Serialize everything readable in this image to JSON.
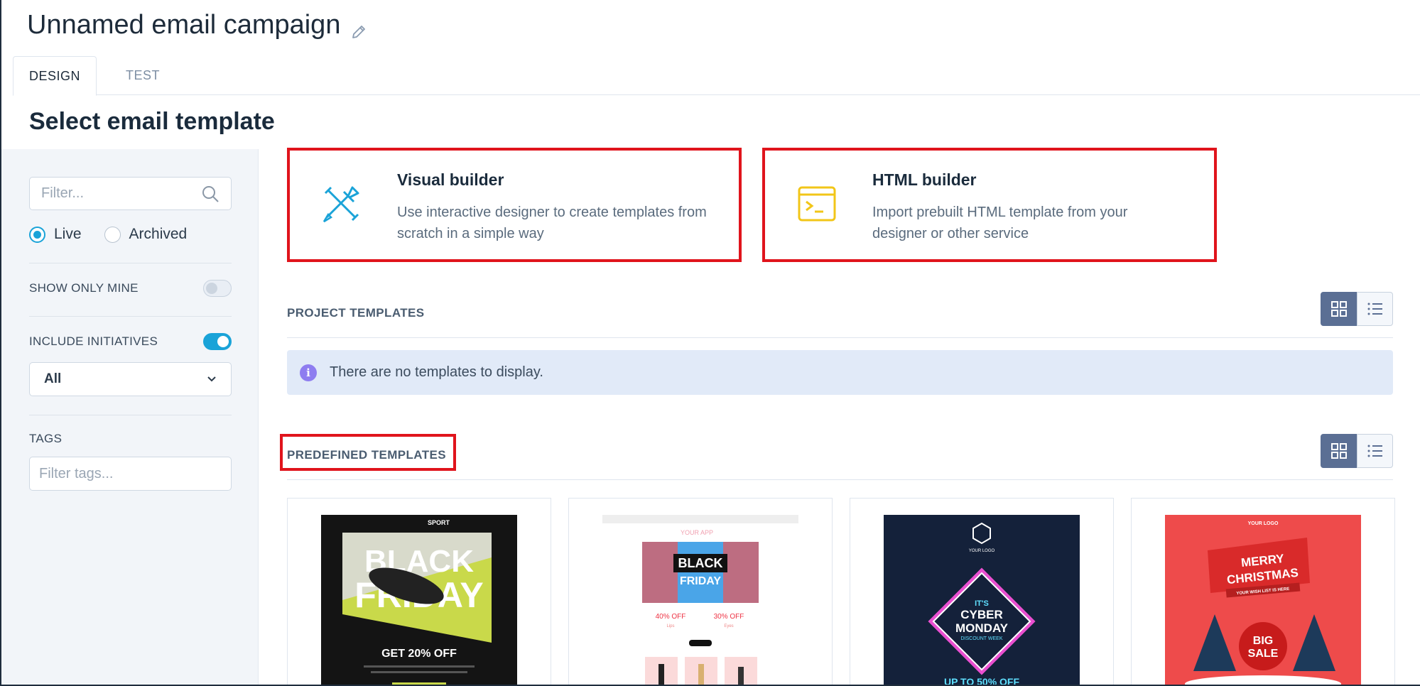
{
  "header": {
    "title": "Unnamed email campaign",
    "edit_icon": "pencil-icon"
  },
  "tabs": [
    {
      "label": "DESIGN",
      "active": true
    },
    {
      "label": "TEST",
      "active": false
    }
  ],
  "section_title": "Select email template",
  "sidebar": {
    "filter_placeholder": "Filter...",
    "status_options": [
      {
        "label": "Live",
        "selected": true
      },
      {
        "label": "Archived",
        "selected": false
      }
    ],
    "show_only_mine": {
      "label": "SHOW ONLY MINE",
      "on": false
    },
    "include_initiatives": {
      "label": "INCLUDE INITIATIVES",
      "on": true
    },
    "initiative_select": {
      "value": "All"
    },
    "tags_label": "TAGS",
    "tags_placeholder": "Filter tags..."
  },
  "builders": {
    "visual": {
      "title": "Visual builder",
      "description": "Use interactive designer to create templates from scratch in a simple way",
      "icon": "brush-pen-icon",
      "icon_color": "#1aa3d8"
    },
    "html": {
      "title": "HTML builder",
      "description": "Import prebuilt HTML template from your designer or other service",
      "icon": "terminal-icon",
      "icon_color": "#f2c618"
    }
  },
  "project_templates": {
    "label": "PROJECT TEMPLATES",
    "empty_message": "There are no templates to display."
  },
  "predefined_templates": {
    "label": "PREDEFINED TEMPLATES",
    "cards": [
      {
        "brand": "SPORT",
        "headline1": "BLACK",
        "headline2": "FRIDAY",
        "offer": "GET 20% OFF"
      },
      {
        "brand": "YOUR APP",
        "headline1": "BLACK",
        "headline2": "FRIDAY",
        "offer_left": "40% OFF",
        "offer_right": "30% OFF",
        "sub_left": "Lips",
        "sub_right": "Eyes"
      },
      {
        "brand": "YOUR LOGO",
        "headline0": "IT'S",
        "headline1": "CYBER",
        "headline2": "MONDAY",
        "sub": "DISCOUNT WEEK",
        "bottom": "UP TO 50% OFF"
      },
      {
        "brand": "YOUR LOGO",
        "headline1": "MERRY",
        "headline2": "CHRISTMAS",
        "sub": "YOUR WISH LIST IS HERE",
        "badge1": "BIG",
        "badge2": "SALE"
      }
    ]
  },
  "view_icons": [
    "grid-icon",
    "list-icon"
  ],
  "colors": {
    "accent": "#1aa3d8",
    "highlight": "#e0141c",
    "view_active": "#5b6f94"
  }
}
